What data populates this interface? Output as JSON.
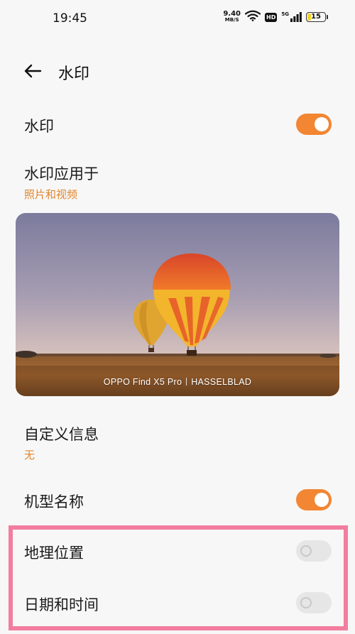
{
  "status": {
    "time": "19:45",
    "speed_value": "9.40",
    "speed_unit": "MB/S",
    "hd_label": "HD",
    "signal_label": "5G",
    "battery": "15"
  },
  "header": {
    "title": "水印",
    "back_icon": "arrow-left-icon"
  },
  "rows": {
    "watermark": {
      "label": "水印",
      "enabled": true
    },
    "apply_to": {
      "label": "水印应用于",
      "value": "照片和视频"
    },
    "custom_info": {
      "label": "自定义信息",
      "value": "无"
    },
    "model_name": {
      "label": "机型名称",
      "enabled": true
    },
    "location": {
      "label": "地理位置",
      "enabled": false
    },
    "datetime": {
      "label": "日期和时间",
      "enabled": false
    }
  },
  "preview": {
    "caption_left": "OPPO Find X5 Pro",
    "caption_right": "HASSELBLAD"
  },
  "colors": {
    "accent": "#f28632",
    "subtext": "#e0862e",
    "highlight": "#f27d9f"
  }
}
